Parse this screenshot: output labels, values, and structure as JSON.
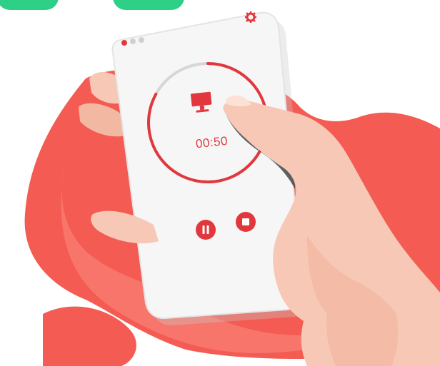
{
  "timer": {
    "display": "00:50",
    "progress": 0.83
  },
  "controls": {
    "pause_icon": "pause-icon",
    "stop_icon": "stop-icon"
  },
  "header": {
    "settings_icon": "gear-icon",
    "status_dots": 3
  },
  "colors": {
    "accent_red": "#e2373d",
    "track_gray": "#d6d6d6",
    "blob_red": "#f45b52",
    "skin": "#f7c8b5",
    "pill_green": "#2ecf86"
  }
}
